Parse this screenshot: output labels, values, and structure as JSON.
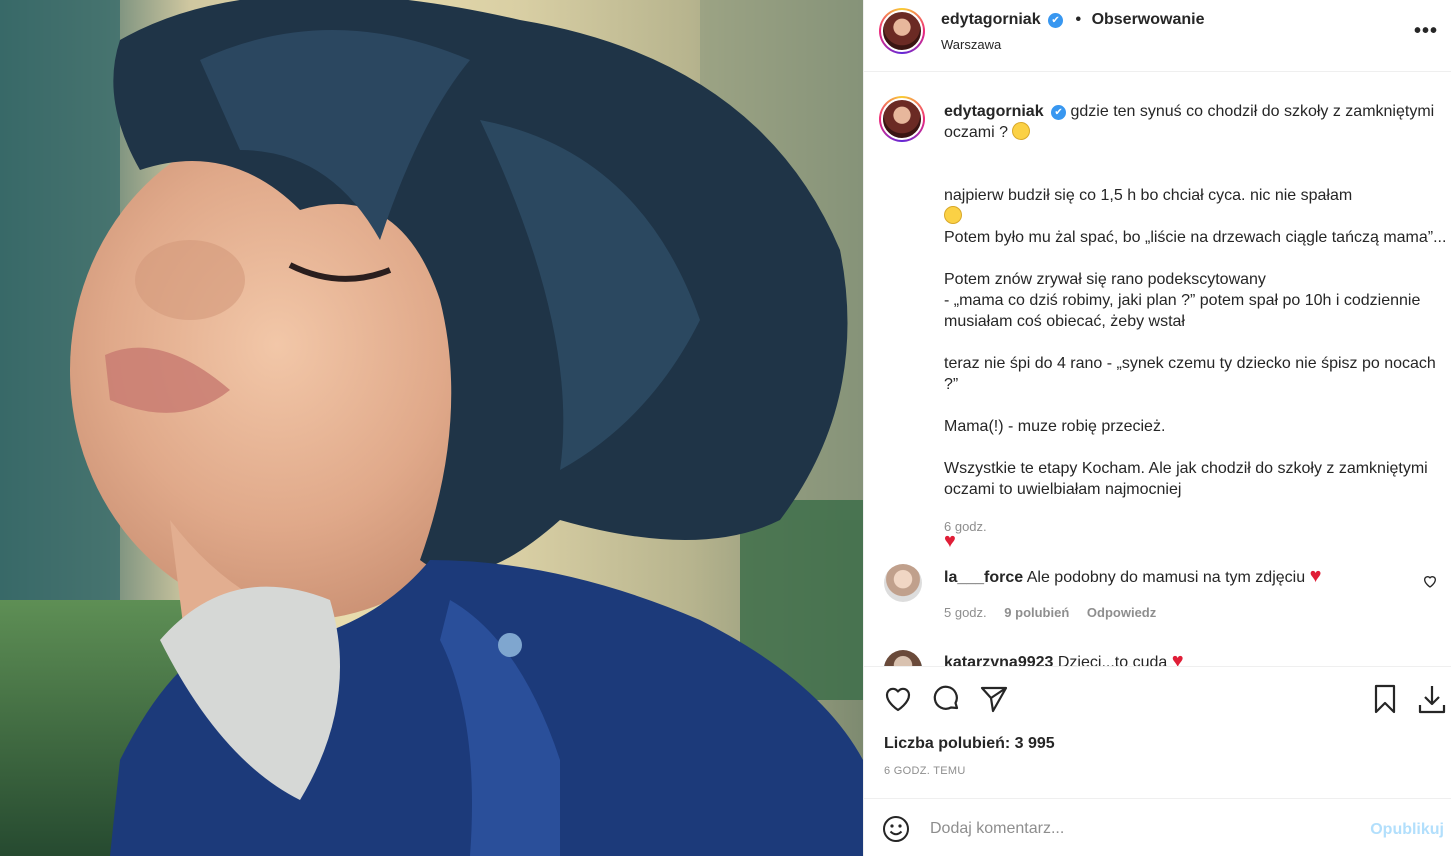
{
  "header": {
    "username": "edytagorniak",
    "verified_badge": "✔",
    "separator": "•",
    "follow_label": "Obserwowanie",
    "location": "Warszawa",
    "more_label": "•••"
  },
  "caption": {
    "username": "edytagorniak",
    "verified_badge": "✔",
    "intro": "gdzie ten synuś co chodził do szkoły z zamkniętymi oczami ?",
    "p1": "najpierw budził się co 1,5 h bo chciał cyca. nic nie spałam",
    "p1b": "Potem było mu żal spać, bo „liście na drzewach ciągle tańczą mama”...",
    "p2": "Potem znów zrywał się rano podekscytowany\n- „mama co dziś robimy, jaki plan ?” potem spał po 10h i codziennie musiałam coś obiecać, żeby wstał",
    "p3": "teraz nie śpi do 4 rano - „synek czemu ty dziecko nie śpisz po nocach ?”",
    "p4": "Mama(!) - muze robię przecież.",
    "p5": "Wszystkie te etapy Kocham. Ale jak chodził do szkoły z zamkniętymi oczami to uwielbiałam najmocniej",
    "heart": "♥",
    "time": "6 godz."
  },
  "comments": [
    {
      "username": "la___force",
      "text": "Ale podobny do mamusi na tym zdjęciu",
      "heart": "♥",
      "time": "5 godz.",
      "likes": "9 polubień",
      "reply": "Odpowiedz"
    },
    {
      "username": "katarzyna9923",
      "text": "Dzieci...to cuda",
      "heart": "♥"
    }
  ],
  "actions": {
    "likes": "Liczba polubień: 3 995",
    "ago": "6 GODZ. TEMU"
  },
  "add_comment": {
    "placeholder": "Dodaj komentarz...",
    "publish": "Opublikuj"
  },
  "icons": [
    "heart-icon",
    "comment-icon",
    "share-icon",
    "bookmark-icon",
    "download-icon",
    "emoji-icon",
    "more-icon"
  ],
  "colors": {
    "verified": "#3897f0",
    "heart": "#e01e37",
    "publish_disabled": "#b2dffc",
    "muted": "#8e8e8e"
  }
}
